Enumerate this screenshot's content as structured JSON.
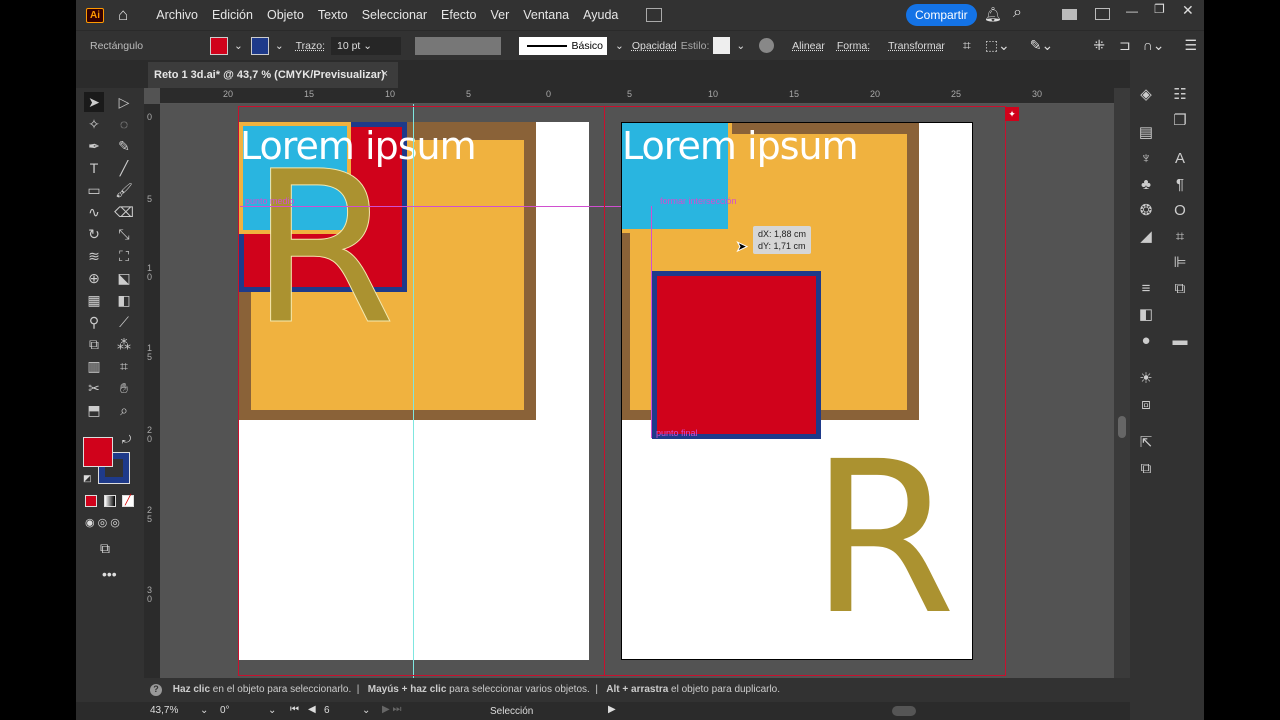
{
  "app": {
    "logo": "Ai",
    "menu": [
      "Archivo",
      "Edición",
      "Objeto",
      "Texto",
      "Seleccionar",
      "Efecto",
      "Ver",
      "Ventana",
      "Ayuda"
    ],
    "share": "Compartir"
  },
  "control": {
    "object_type": "Rectángulo",
    "stroke_label": "Trazo:",
    "stroke_value": "10 pt",
    "brush": "Básico",
    "opacity": "Opacidad",
    "style": "Estilo:",
    "align": "Alinear",
    "shape": "Forma:",
    "transform": "Transformar",
    "fill_color": "#d0021b",
    "stroke_color": "#1e3a8a"
  },
  "tab": {
    "title": "Reto 1 3d.ai* @ 43,7 % (CMYK/Previsualizar)",
    "close": "×"
  },
  "rulers": {
    "top": [
      "20",
      "15",
      "10",
      "5",
      "0",
      "5",
      "10",
      "15",
      "20",
      "25",
      "30"
    ],
    "left": [
      "0",
      "5",
      "1 0",
      "1 5",
      "2 0",
      "2 5",
      "3 0"
    ]
  },
  "artwork": {
    "heading": "Lorem ipsum",
    "letter": "R",
    "guides": {
      "midpoint": "punto medio",
      "intersect": "formar intersección",
      "end": "punto final"
    },
    "tooltip": {
      "dx": "dX: 1,88 cm",
      "dy": "dY: 1,71 cm"
    }
  },
  "status": {
    "hint1_bold": "Haz clic",
    "hint1": " en el objeto para seleccionarlo.  |  ",
    "hint2_bold": "Mayús + haz clic",
    "hint2": " para seleccionar varios objetos.  |  ",
    "hint3_bold": "Alt + arrastra",
    "hint3": " el objeto para duplicarlo."
  },
  "bottom": {
    "zoom": "43,7%",
    "rotation": "0°",
    "artboard": "6",
    "tool": "Selección"
  }
}
